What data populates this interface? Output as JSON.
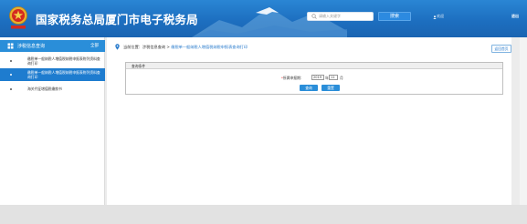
{
  "header": {
    "site_title": "国家税务总局厦门市电子税务局",
    "search_placeholder": "请输入关键字",
    "search_button": "搜索",
    "user_name": "欢迎",
    "logout": "退出"
  },
  "sidebar": {
    "header_label": "涉税信息查询",
    "header_action": "全部",
    "items": [
      {
        "label": "缴税单一般纳税人增值税纳税申报表附列资料查询打印",
        "active": false
      },
      {
        "label": "缴税单一般纳税人增值税纳税申报表附列资料查询打印",
        "active": true
      },
      {
        "label": "海关代征增值税缴款书",
        "active": false
      }
    ]
  },
  "main": {
    "breadcrumb_prefix": "当前位置：",
    "breadcrumb_parent": "涉税信息查询",
    "breadcrumb_sep": " > ",
    "breadcrumb_current": "缴税单一般纳税人增值税纳税申报表查询打印",
    "back_button": "返回首页",
    "panel_title": "查询条件",
    "field_label": "所属申报期：",
    "year_value": "2019",
    "year_unit": "年",
    "month_value": "11",
    "month_unit": "月",
    "query_button": "查询",
    "reset_button": "重置"
  },
  "colors": {
    "header_blue": "#1d6fc0",
    "accent_blue": "#2a8ed9",
    "link_blue": "#2a7ccd"
  }
}
